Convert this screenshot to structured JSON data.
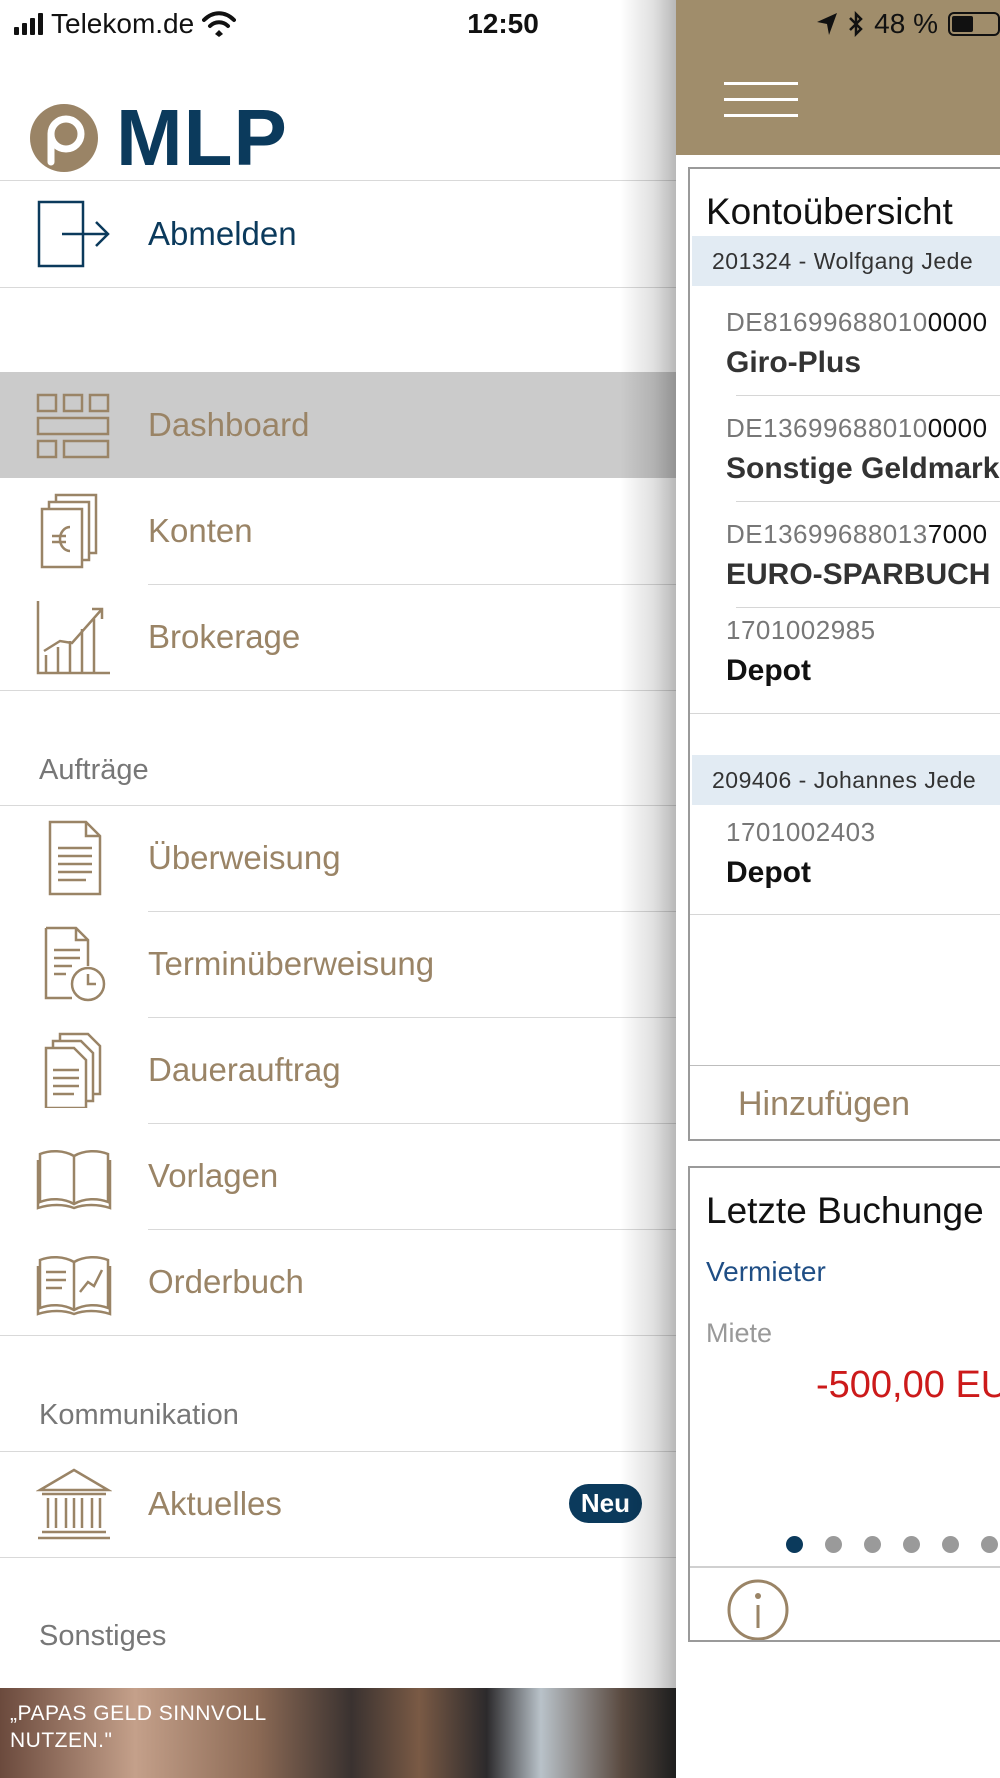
{
  "status_bar": {
    "carrier": "Telekom.de",
    "time": "12:50",
    "battery": "48 %",
    "battery_level": 0.48
  },
  "brand": {
    "logo_text": "MLP",
    "accent": "#9a8466",
    "navy": "#0b3a5c",
    "header_bg": "#a08d6b"
  },
  "menu": {
    "logout": "Abmelden",
    "main_items": [
      {
        "label": "Dashboard",
        "icon": "dashboard-icon",
        "active": true
      },
      {
        "label": "Konten",
        "icon": "euro-docs-icon"
      },
      {
        "label": "Brokerage",
        "icon": "chart-growth-icon"
      }
    ],
    "sections": {
      "orders": "Aufträge",
      "communication": "Kommunikation",
      "other": "Sonstiges"
    },
    "order_items": [
      {
        "label": "Überweisung",
        "icon": "document-icon"
      },
      {
        "label": "Terminüberweisung",
        "icon": "document-clock-icon"
      },
      {
        "label": "Dauerauftrag",
        "icon": "documents-stack-icon"
      },
      {
        "label": "Vorlagen",
        "icon": "open-book-icon"
      },
      {
        "label": "Orderbuch",
        "icon": "book-chart-icon"
      }
    ],
    "communication_items": [
      {
        "label": "Aktuelles",
        "icon": "bank-building-icon",
        "badge": "Neu"
      }
    ],
    "promo_text_line1": "„PAPAS GELD SINNVOLL",
    "promo_text_line2": "NUTZEN.\""
  },
  "dashboard": {
    "accounts_card": {
      "title": "Kontoübersicht",
      "groups": [
        {
          "header": "201324 - Wolfgang Jede",
          "accounts": [
            {
              "iban_prefix": "DE81699688010",
              "iban_rest": "0000",
              "name": "Giro-Plus"
            },
            {
              "iban_prefix": "DE13699688010",
              "iban_rest": "0000",
              "name": "Sonstige Geldmark"
            },
            {
              "iban_prefix": "DE13699688013",
              "iban_rest": "7000",
              "name": "EURO-SPARBUCH"
            },
            {
              "iban_prefix": "1701002985",
              "iban_rest": "",
              "name": "Depot"
            }
          ]
        },
        {
          "header": "209406 - Johannes Jede",
          "accounts": [
            {
              "iban_prefix": "1701002403",
              "iban_rest": "",
              "name": "Depot"
            }
          ]
        }
      ],
      "add_label": "Hinzufügen"
    },
    "bookings_card": {
      "title": "Letzte Buchunge",
      "partner": "Vermieter",
      "purpose": "Miete",
      "amount": "-500,00 EU",
      "active_page": 1,
      "page_count": 6
    }
  }
}
